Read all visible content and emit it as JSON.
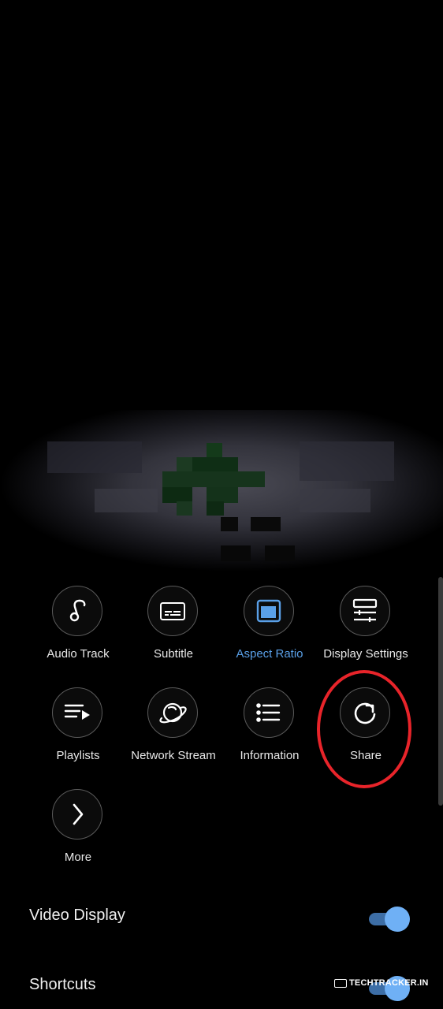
{
  "menu": {
    "items": [
      {
        "label": "Audio Track",
        "icon": "music-note-icon"
      },
      {
        "label": "Subtitle",
        "icon": "subtitle-icon"
      },
      {
        "label": "Aspect Ratio",
        "icon": "aspect-ratio-icon",
        "active": true
      },
      {
        "label": "Display Settings",
        "icon": "sliders-icon"
      },
      {
        "label": "Playlists",
        "icon": "playlist-icon"
      },
      {
        "label": "Network Stream",
        "icon": "planet-icon"
      },
      {
        "label": "Information",
        "icon": "list-icon"
      },
      {
        "label": "Share",
        "icon": "share-icon"
      },
      {
        "label": "More",
        "icon": "chevron-right-icon"
      }
    ]
  },
  "settings": {
    "video_display": {
      "label": "Video Display",
      "enabled": true
    },
    "shortcuts": {
      "label": "Shortcuts",
      "enabled": true
    }
  },
  "watermark": {
    "text": "TECHTRACKER.IN"
  },
  "colors": {
    "accent": "#5aa0e8",
    "toggle_track": "#3d6ea6",
    "toggle_knob": "#6fb0f5",
    "highlight": "#e8242a",
    "background": "#000000"
  }
}
